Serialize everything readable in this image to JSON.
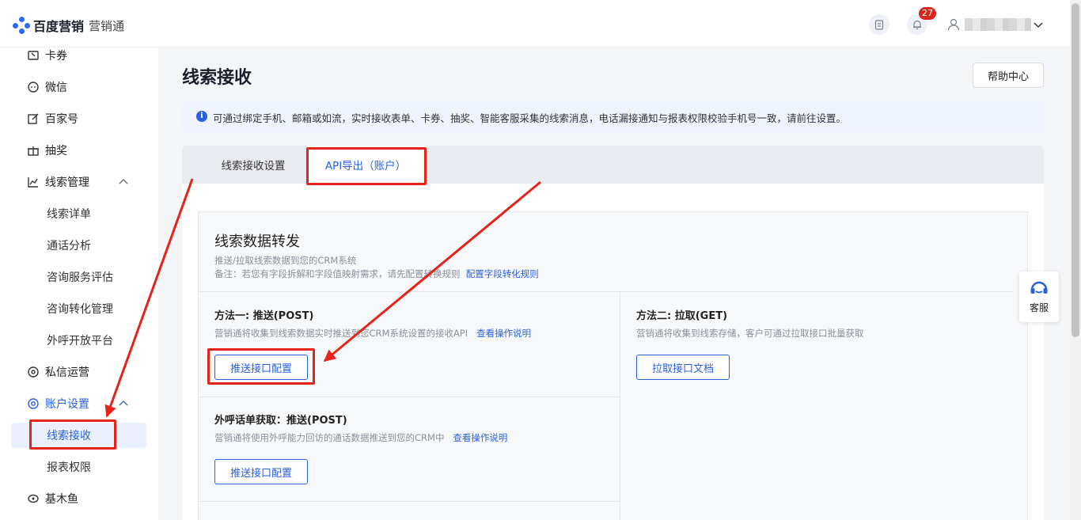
{
  "header": {
    "brand": "百度营销",
    "product": "营销通",
    "notification_count": "27"
  },
  "sidebar": {
    "items": [
      {
        "label": "卡券"
      },
      {
        "label": "微信"
      },
      {
        "label": "百家号"
      },
      {
        "label": "抽奖"
      },
      {
        "label": "线索管理"
      },
      {
        "label": "线索详单"
      },
      {
        "label": "通话分析"
      },
      {
        "label": "咨询服务评估"
      },
      {
        "label": "咨询转化管理"
      },
      {
        "label": "外呼开放平台"
      },
      {
        "label": "私信运营"
      },
      {
        "label": "账户设置"
      },
      {
        "label": "线索接收"
      },
      {
        "label": "报表权限"
      },
      {
        "label": "基木鱼"
      }
    ]
  },
  "page": {
    "title": "线索接收",
    "help_label": "帮助中心",
    "notice": "可通过绑定手机、邮箱或如流，实时接收表单、卡券、抽奖、智能客服采集的线索消息，电话漏接通知与报表权限校验手机号一致，请前往设置。"
  },
  "tabs": [
    {
      "label": "线索接收设置"
    },
    {
      "label": "API导出（账户）"
    }
  ],
  "forward": {
    "title": "线索数据转发",
    "subtitle": "推送/拉取线索数据到您的CRM系统",
    "note": "备注：若您有字段拆解和字段值映射需求，请先配置转换规则",
    "note_link": "配置字段转化规则"
  },
  "method_push": {
    "title": "方法一: 推送(POST)",
    "desc": "营销通将收集到线索数据实时推送到您CRM系统设置的接收API",
    "link": "查看操作说明",
    "button": "推送接口配置"
  },
  "method_pull": {
    "title": "方法二: 拉取(GET)",
    "desc": "营销通将收集到线索存储，客户可通过拉取接口批量获取",
    "button": "拉取接口文档"
  },
  "call_push": {
    "title": "外呼话单获取：推送(POST)",
    "desc": "营销通将使用外呼能力回访的通话数据推送到您的CRM中",
    "link": "查看操作说明",
    "button": "推送接口配置"
  },
  "service": {
    "label": "客服"
  },
  "colors": {
    "accent": "#2a5fe0",
    "annotation": "#e5231b",
    "badge": "#d9261c"
  }
}
